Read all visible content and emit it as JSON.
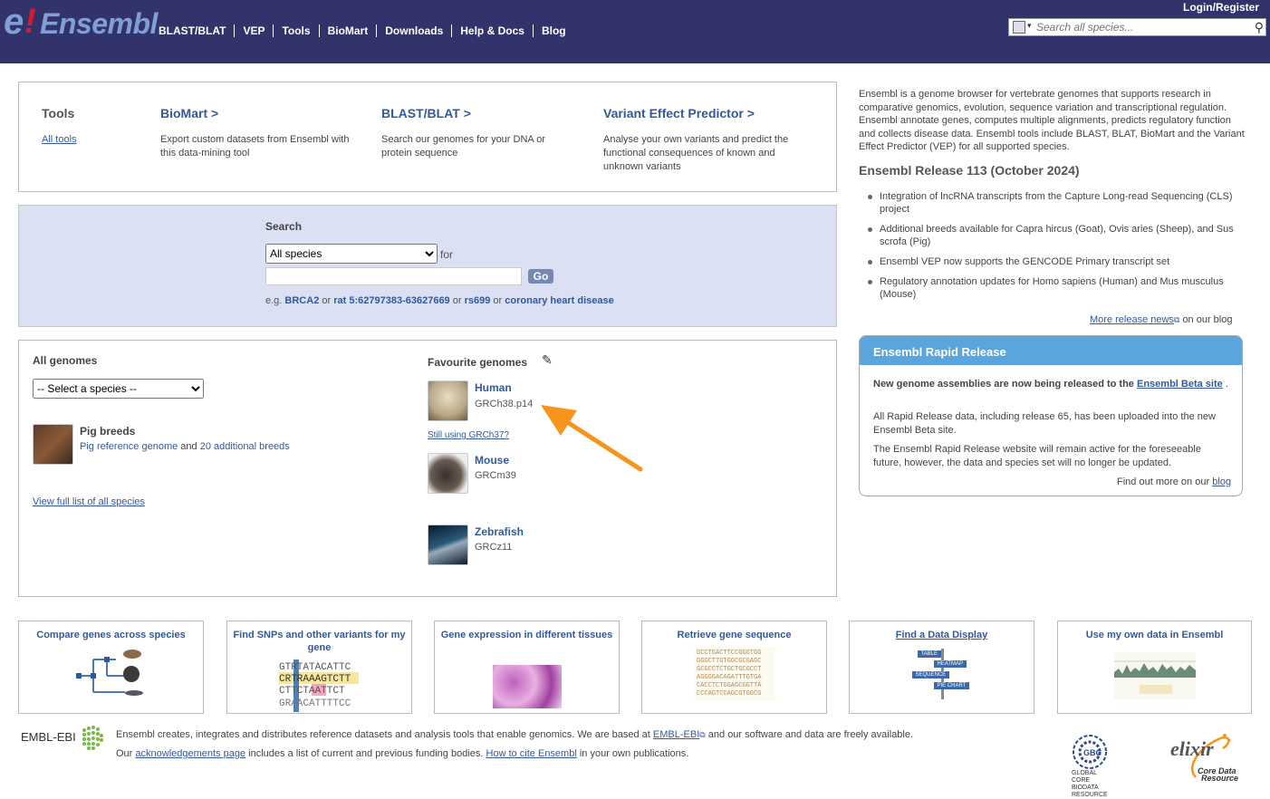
{
  "header": {
    "logo_e": "e",
    "logo_bang": "!",
    "logo_text": "Ensembl",
    "nav": [
      "BLAST/BLAT",
      "VEP",
      "Tools",
      "BioMart",
      "Downloads",
      "Help & Docs",
      "Blog"
    ],
    "login": "Login/Register",
    "search_placeholder": "Search all species..."
  },
  "tools": {
    "title": "Tools",
    "all_tools": "All tools",
    "biomart_title": "BioMart  >",
    "biomart_desc": "Export custom datasets from Ensembl with this data-mining tool",
    "blast_title": "BLAST/BLAT  >",
    "blast_desc": "Search our genomes for your DNA or protein sequence",
    "vep_title": "Variant Effect Predictor  >",
    "vep_desc": "Analyse your own variants and predict the functional consequences of known and unknown variants"
  },
  "search": {
    "label": "Search",
    "species_selected": "All species",
    "for": "for",
    "go": "Go",
    "eg_prefix": "e.g.",
    "ex1": "BRCA2",
    "or1": "or",
    "ex2": "rat 5:62797383-63627669",
    "or2": "or",
    "ex3": "rs699",
    "or3": "or",
    "ex4": "coronary heart disease"
  },
  "genomes": {
    "all_title": "All genomes",
    "select_species": "-- Select a species --",
    "pig_title": "Pig breeds",
    "pig_ref": "Pig reference genome",
    "pig_and": "and",
    "pig_breeds": "20 additional breeds",
    "view_all": "View full list of all species",
    "fav_title": "Favourite genomes",
    "favs": [
      {
        "name": "Human",
        "assembly": "GRCh38.p14"
      },
      {
        "name": "Mouse",
        "assembly": "GRCm39"
      },
      {
        "name": "Zebrafish",
        "assembly": "GRCz11"
      }
    ],
    "still_grch37": "Still using GRCh37?"
  },
  "right": {
    "intro": "Ensembl is a genome browser for vertebrate genomes that supports research in comparative genomics, evolution, sequence variation and transcriptional regulation. Ensembl annotate genes, computes multiple alignments, predicts regulatory function and collects disease data. Ensembl tools include BLAST, BLAT, BioMart and the Variant Effect Predictor (VEP) for all supported species.",
    "release_title": "Ensembl Release 113 (October 2024)",
    "news": [
      "Integration of lncRNA transcripts from the Capture Long-read Sequencing (CLS) project",
      "Additional breeds available for Capra hircus (Goat), Ovis aries (Sheep), and Sus scrofa (Pig)",
      "Ensembl VEP now supports the GENCODE Primary transcript set",
      "Regulatory annotation updates for Homo sapiens (Human) and Mus musculus (Mouse)"
    ],
    "more_news": "More release news",
    "on_blog": "on our blog"
  },
  "rapid": {
    "title": "Ensembl Rapid Release",
    "p1_bold": "New genome assemblies are now being released to the",
    "p1_link": "Ensembl Beta site",
    "p1_end": ".",
    "p2": "All Rapid Release data, including release 65, has been uploaded into the new Ensembl Beta site.",
    "p3": "The Ensembl Rapid Release website will remain active for the foreseeable future, however, the data and species set will no longer be updated.",
    "p4_text": "Find out more on our",
    "p4_link": "blog"
  },
  "features": [
    {
      "title": "Compare genes across species"
    },
    {
      "title": "Find SNPs and other variants for my gene"
    },
    {
      "title": "Gene expression in different tissues"
    },
    {
      "title": "Retrieve gene sequence"
    },
    {
      "title": "Find a Data Display"
    },
    {
      "title": "Use my own data in Ensembl"
    }
  ],
  "data_display_signs": [
    "TABLE",
    "HEATMAP",
    "SEQUENCE",
    "PIE CHART"
  ],
  "footer": {
    "embl": "EMBL-EBI",
    "line1_a": "Ensembl creates, integrates and distributes reference datasets and analysis tools that enable genomics. We are based at",
    "line1_link": "EMBL-EBI",
    "line1_b": "and our software and data are freely available.",
    "line2_a": "Our",
    "line2_link1": "acknowledgements page",
    "line2_b": "includes a list of current and previous funding bodies.",
    "line2_link2": "How to cite Ensembl",
    "line2_c": "in your own publications.",
    "gbc": [
      "GLOBAL",
      "CORE",
      "BIODATA",
      "RESOURCE"
    ],
    "elixir": "elixir",
    "elixir_sub1": "Core Data",
    "elixir_sub2": "Resource"
  },
  "colors": {
    "header": "#33336b",
    "link": "#33599b",
    "search_bg": "#dbe0f2",
    "rapid_header": "#5aa6dc",
    "arrow": "#f7941d"
  }
}
